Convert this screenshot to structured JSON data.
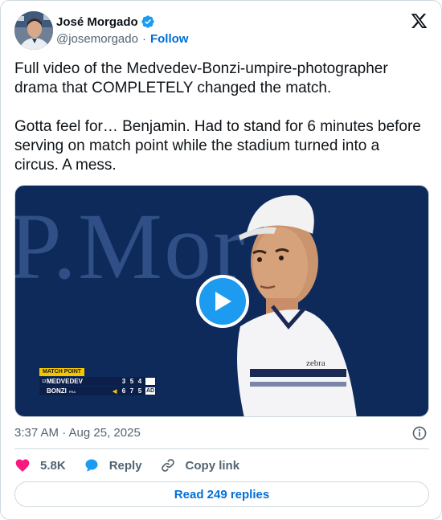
{
  "author": {
    "name": "José Morgado",
    "handle": "@josemorgado",
    "separator": "·",
    "follow_label": "Follow",
    "verified": true
  },
  "tweet": {
    "paragraphs": [
      "Full video of the Medvedev-Bonzi-umpire-photographer drama that COMPLETELY changed the match.",
      "Gotta feel for… Benjamin. Had to stand for 6 minutes before serving on match point while the stadium turned into a circus. A mess."
    ],
    "timestamp": "3:37 AM · Aug 25, 2025"
  },
  "media": {
    "type": "video",
    "background_text": "P.Mor",
    "shirt_logo": "zebra",
    "scoreboard": {
      "banner": "MATCH POINT",
      "rows": [
        {
          "seed": "13",
          "player": "MEDVEDEV",
          "country": "",
          "serving": false,
          "sets": [
            "3",
            "5",
            "4"
          ],
          "game": ""
        },
        {
          "seed": "",
          "player": "BONZI",
          "country": "FRA",
          "serving": true,
          "sets": [
            "6",
            "7",
            "5"
          ],
          "game": "AD"
        }
      ]
    }
  },
  "actions": {
    "likes": "5.8K",
    "reply": "Reply",
    "copy_link": "Copy link"
  },
  "read_replies": "Read 249 replies",
  "colors": {
    "accent": "#1d9bf0",
    "link": "#006fd6",
    "like": "#f91880",
    "muted": "#536471",
    "border": "#cfd9de"
  }
}
